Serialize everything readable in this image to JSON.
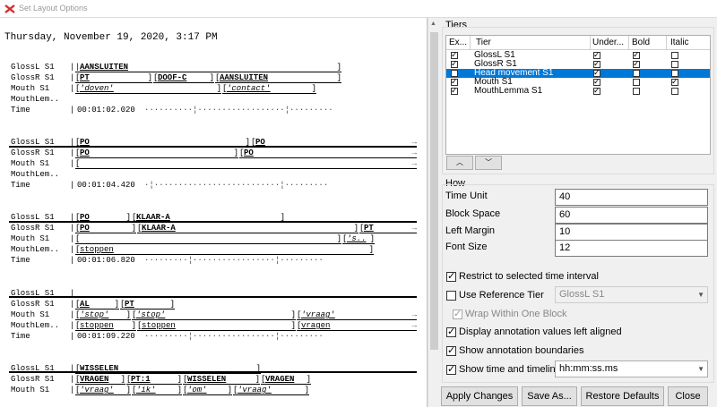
{
  "window": {
    "title": "Set Layout Options"
  },
  "preview": {
    "date": "Thursday, November 19, 2020, 3:17 PM",
    "blocks": [
      {
        "rows": [
          {
            "name": "GlossL S1"
          },
          {
            "name": "GlossR S1"
          },
          {
            "name": "Mouth S1"
          },
          {
            "name": "MouthLem.."
          },
          {
            "name": "Time"
          }
        ],
        "annotations": {
          "a1": "AANSLUITEN",
          "a2": "PT",
          "a3": "DOOF-C",
          "a4": "AANSLUITEN",
          "a5": "'doven'",
          "a6": "'contact'"
        },
        "time": "00:01:02.020"
      },
      {
        "rows": [
          {
            "name": "GlossL S1"
          },
          {
            "name": "GlossR S1"
          },
          {
            "name": "Mouth S1"
          },
          {
            "name": "MouthLem.."
          },
          {
            "name": "Time"
          }
        ],
        "annotations": {
          "a1": "PO",
          "a2": "PO",
          "a3": "PO",
          "a4": "PO"
        },
        "time": "00:01:04.420"
      },
      {
        "rows": [
          {
            "name": "GlossL S1"
          },
          {
            "name": "GlossR S1"
          },
          {
            "name": "Mouth S1"
          },
          {
            "name": "MouthLem.."
          },
          {
            "name": "Time"
          }
        ],
        "annotations": {
          "a1": "PO",
          "a2": "KLAAR-A",
          "a3": "PO",
          "a4": "KLAAR-A",
          "a5": "PT",
          "a6": "'s..",
          "a7": "stoppen"
        },
        "time": "00:01:06.820"
      },
      {
        "rows": [
          {
            "name": "GlossL S1"
          },
          {
            "name": "GlossR S1"
          },
          {
            "name": "Mouth S1"
          },
          {
            "name": "MouthLem.."
          },
          {
            "name": "Time"
          }
        ],
        "annotations": {
          "a1": "AL",
          "a2": "PT",
          "a3": "'stop'",
          "a4": "'stop'",
          "a5": "'vraag'",
          "a6": "stoppen",
          "a7": "stoppen",
          "a8": "vragen"
        },
        "time": "00:01:09.220"
      },
      {
        "rows": [
          {
            "name": "GlossL S1"
          },
          {
            "name": "GlossR S1"
          },
          {
            "name": "Mouth S1"
          }
        ],
        "annotations": {
          "a1": "WISSELEN",
          "a2": "VRAGEN",
          "a3": "PT:1",
          "a4": "WISSELEN",
          "a5": "VRAGEN",
          "a6": "'vraag'",
          "a7": "'ik'",
          "a8": "'om'",
          "a9": "'vraag'"
        }
      }
    ]
  },
  "tiers": {
    "group_label": "Tiers",
    "columns": [
      "Ex...",
      "Tier",
      "Under...",
      "Bold",
      "Italic"
    ],
    "rows": [
      {
        "tier": "GlossL S1",
        "export": true,
        "underline": true,
        "bold": true,
        "italic": false,
        "selected": false
      },
      {
        "tier": "GlossR S1",
        "export": true,
        "underline": true,
        "bold": true,
        "italic": false,
        "selected": false
      },
      {
        "tier": "Head movement S1",
        "export": false,
        "underline": true,
        "bold": false,
        "italic": false,
        "selected": true
      },
      {
        "tier": "Mouth S1",
        "export": true,
        "underline": true,
        "bold": false,
        "italic": true,
        "selected": false
      },
      {
        "tier": "MouthLemma S1",
        "export": true,
        "underline": true,
        "bold": false,
        "italic": false,
        "selected": false
      }
    ],
    "move_up_icon": "chevron-up-icon",
    "move_down_icon": "chevron-down-icon"
  },
  "how": {
    "group_label": "How",
    "time_unit_label": "Time Unit",
    "time_unit_value": "40",
    "block_space_label": "Block Space",
    "block_space_value": "60",
    "left_margin_label": "Left Margin",
    "left_margin_value": "10",
    "font_size_label": "Font Size",
    "font_size_value": "12",
    "restrict_label": "Restrict to selected time interval",
    "restrict_checked": true,
    "use_ref_label": "Use Reference Tier",
    "use_ref_checked": false,
    "ref_tier_value": "GlossL S1",
    "wrap_label": "Wrap Within One Block",
    "wrap_checked": true,
    "display_left_label": "Display annotation values left aligned",
    "display_left_checked": true,
    "show_boundaries_label": "Show annotation boundaries",
    "show_boundaries_checked": true,
    "show_time_label": "Show time and timeline",
    "show_time_checked": true,
    "time_format_value": "hh:mm:ss.ms"
  },
  "buttons": {
    "apply": "Apply Changes",
    "save_as": "Save As...",
    "restore": "Restore Defaults",
    "close": "Close"
  },
  "colors": {
    "selection": "#0078d7",
    "window_bg": "#f0f0f0"
  }
}
